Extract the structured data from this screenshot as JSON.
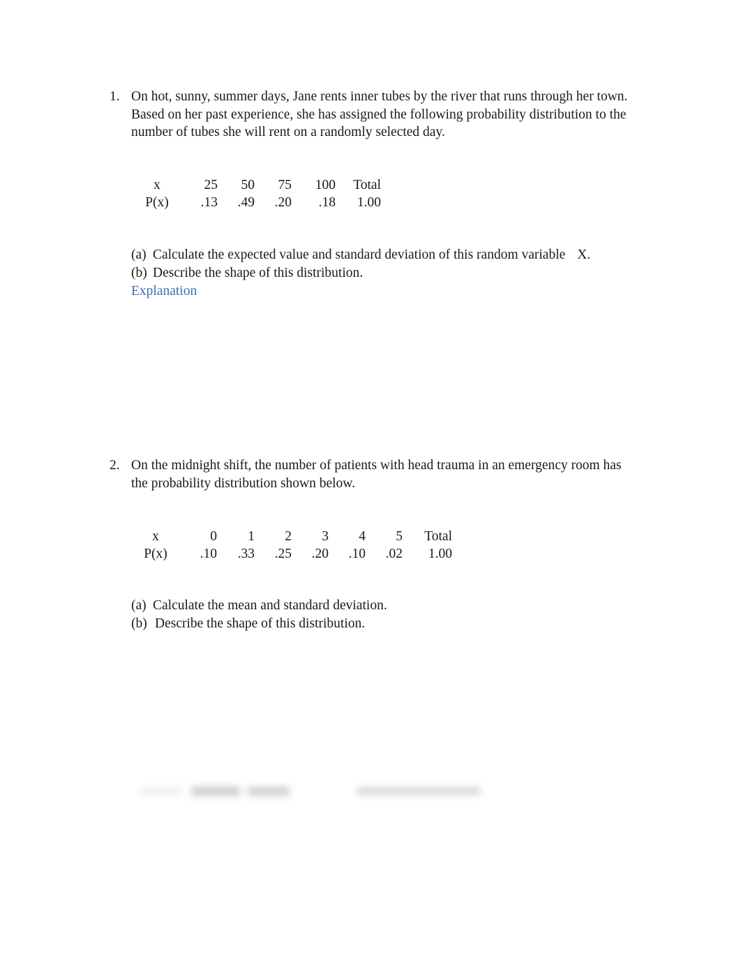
{
  "document": {
    "background_color": "#ffffff",
    "text_color": "#1a1a1a",
    "link_color": "#3c70b4"
  },
  "problems": [
    {
      "number": "1.",
      "prompt": "On hot, sunny, summer days, Jane rents inner tubes by the river that runs through her town. Based on her past experience, she has assigned the following probability distribution to the number of tubes she will rent on a randomly selected day.",
      "table": {
        "row_labels": [
          "x",
          "P(x)"
        ],
        "x_values": [
          "25",
          "50",
          "75",
          "100"
        ],
        "probabilities": [
          ".13",
          ".49",
          ".20",
          ".18"
        ],
        "total_label": "Total",
        "total_value": "1.00"
      },
      "questions": [
        {
          "marker": "(a)",
          "text": "Calculate the expected value and standard deviation of this random variable",
          "variable": "X."
        },
        {
          "marker": "(b)",
          "text": "Describe the shape of this distribution.",
          "variable": ""
        }
      ],
      "explanation_label": "Explanation"
    },
    {
      "number": "2.",
      "prompt": "On the midnight shift, the number of patients with head trauma in an emergency room has the probability distribution shown below.",
      "table": {
        "row_labels": [
          "x",
          "P(x)"
        ],
        "x_values": [
          "0",
          "1",
          "2",
          "3",
          "4",
          "5"
        ],
        "probabilities": [
          ".10",
          ".33",
          ".25",
          ".20",
          ".10",
          ".02"
        ],
        "total_label": "Total",
        "total_value": "1.00"
      },
      "questions": [
        {
          "marker": "(a)",
          "text": "Calculate the mean and standard deviation.",
          "variable": ""
        },
        {
          "marker": "(b)",
          "text": "Describe the shape of this distribution.",
          "variable": ""
        }
      ],
      "explanation_label": ""
    }
  ],
  "chart_data": [
    {
      "type": "table",
      "title": "Probability distribution for number of inner tubes rented",
      "xlabel": "x",
      "ylabel": "P(x)",
      "categories": [
        "25",
        "50",
        "75",
        "100"
      ],
      "values": [
        0.13,
        0.49,
        0.2,
        0.18
      ],
      "total": 1.0
    },
    {
      "type": "table",
      "title": "Probability distribution for number of head trauma patients",
      "xlabel": "x",
      "ylabel": "P(x)",
      "categories": [
        "0",
        "1",
        "2",
        "3",
        "4",
        "5"
      ],
      "values": [
        0.1,
        0.33,
        0.25,
        0.2,
        0.1,
        0.02
      ],
      "total": 1.0
    }
  ]
}
